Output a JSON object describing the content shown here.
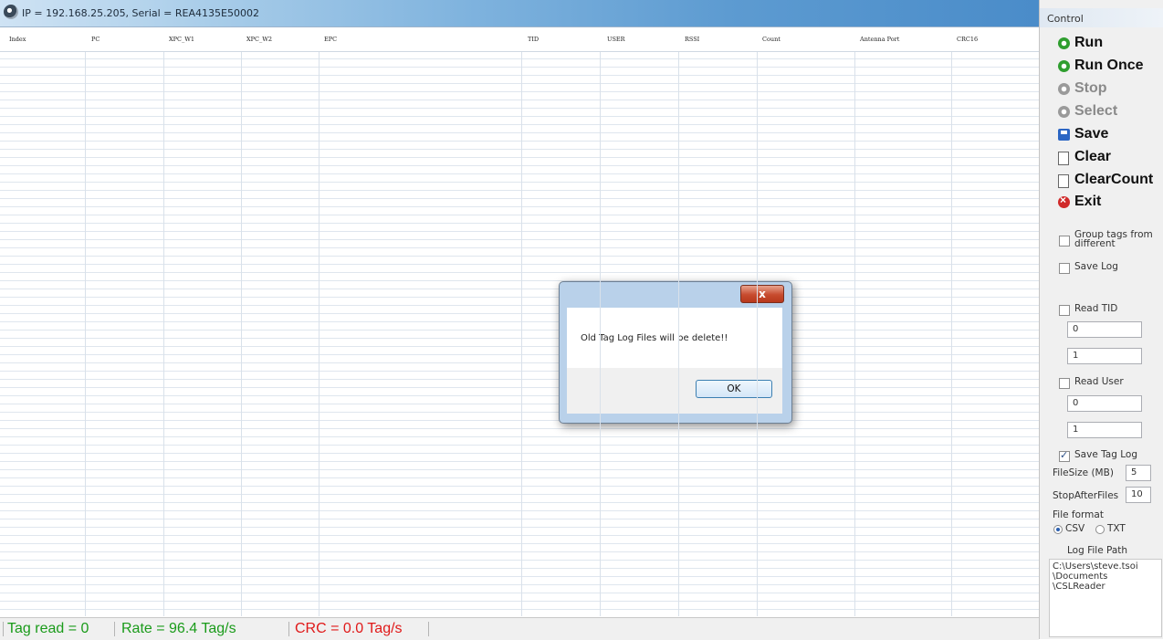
{
  "window": {
    "title": "IP = 192.168.25.205, Serial = REA4135E50002"
  },
  "table": {
    "columns": [
      "Index",
      "PC",
      "XPC_W1",
      "XPC_W2",
      "EPC",
      "TID",
      "USER",
      "RSSI",
      "Count",
      "Antenna Port",
      "CRC16"
    ]
  },
  "status": {
    "tag_read": "Tag read = 0",
    "rate": "Rate = 96.4 Tag/s",
    "crc": "CRC = 0.0 Tag/s",
    "colors": {
      "tag_read": "#1a9b1a",
      "rate": "#1a9b1a",
      "crc": "#e01919"
    }
  },
  "control": {
    "title": "Control",
    "buttons": {
      "run": "Run",
      "run_once": "Run Once",
      "stop": "Stop",
      "select": "Select",
      "save": "Save",
      "clear": "Clear",
      "clear_count": "ClearCount",
      "exit": "Exit"
    },
    "group_tags": {
      "label": "Group tags from different",
      "checked": false
    },
    "save_log": {
      "label": "Save Log",
      "checked": false
    },
    "read_tid": {
      "label": "Read TID",
      "checked": false,
      "offset": "0",
      "length": "1"
    },
    "read_user": {
      "label": "Read User",
      "checked": false,
      "offset": "0",
      "length": "1"
    },
    "save_tag_log": {
      "label": "Save Tag Log",
      "checked": true
    },
    "file_size": {
      "label": "FileSize (MB)",
      "value": "5"
    },
    "stop_after_files": {
      "label": "StopAfterFiles",
      "value": "10"
    },
    "file_format": {
      "label": "File format",
      "options": [
        "CSV",
        "TXT"
      ],
      "selected": "CSV"
    },
    "log_file_path": {
      "label": "Log File Path",
      "value": "C:\\Users\\steve.tsoi\n\\Documents\n\\CSLReader"
    }
  },
  "dialog": {
    "close": "x",
    "message": "Old Tag Log Files will be delete!!",
    "ok": "OK"
  }
}
